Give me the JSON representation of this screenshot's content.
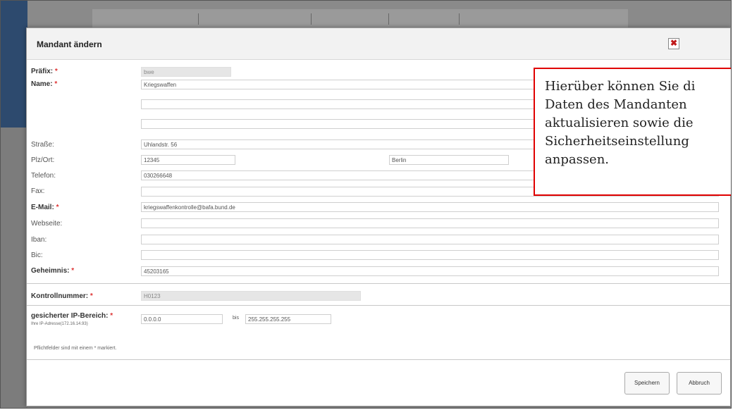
{
  "dialog": {
    "title": "Mandant ändern",
    "close_label": "✖"
  },
  "form": {
    "praefix_label": "Präfix:",
    "praefix_value": "bwe",
    "name_label": "Name:",
    "name_value": "Kriegswaffen",
    "name2_value": "",
    "name3_value": "",
    "strasse_label": "Straße:",
    "strasse_value": "Uhlandstr. 56",
    "plzort_label": "Plz/Ort:",
    "plz_value": "12345",
    "ort_value": "Berlin",
    "telefon_label": "Telefon:",
    "telefon_value": "030266648",
    "fax_label": "Fax:",
    "fax_value": "",
    "email_label": "E-Mail:",
    "email_value": "kriegswaffenkontrolle@bafa.bund.de",
    "webseite_label": "Webseite:",
    "webseite_value": "",
    "iban_label": "Iban:",
    "iban_value": "",
    "bic_label": "Bic:",
    "bic_value": "",
    "geheimnis_label": "Geheimnis:",
    "geheimnis_value": "45203165",
    "kontrollnummer_label": "Kontrollnummer:",
    "kontrollnummer_value": "H0123",
    "ip_label": "gesicherter IP-Bereich:",
    "ip_sub": "Ihre IP-Adresse(172.16.14.93)",
    "ip_from_value": "0.0.0.0",
    "ip_bis_label": "bis",
    "ip_to_value": "255.255.255.255",
    "pflicht_note": "Pflichtfelder sind mit einem * markiert.",
    "required_mark": "*"
  },
  "buttons": {
    "save_label": "Speichern",
    "cancel_label": "Abbruch"
  },
  "callout": {
    "text": "Hierüber können Sie di\nDaten des Mandanten\naktualisieren sowie die\nSicherheitseinstellung\nanpassen."
  }
}
